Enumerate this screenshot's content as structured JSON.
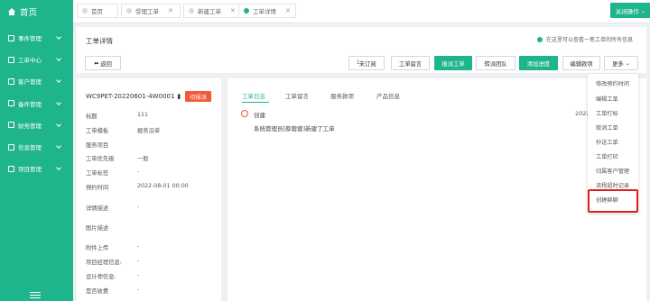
{
  "sidebar": {
    "home": "首页",
    "items": [
      {
        "label": "事件管理"
      },
      {
        "label": "工单中心"
      },
      {
        "label": "客户管理"
      },
      {
        "label": "备件管理"
      },
      {
        "label": "财务管理"
      },
      {
        "label": "信息管理"
      },
      {
        "label": "项目管理"
      }
    ]
  },
  "tabs": [
    {
      "label": "首页"
    },
    {
      "label": "受理工单"
    },
    {
      "label": "新建工单"
    },
    {
      "label": "工单详情"
    }
  ],
  "close_ops": "关闭操作",
  "page": {
    "title": "工单详情",
    "hint": "在这里可以查看一笔工单的所有信息",
    "back": "返回"
  },
  "toolbar": {
    "subscribe": "未订阅",
    "message": "工单留言",
    "dispatch": "报派工单",
    "transfer": "转派团队",
    "add_progress": "添加进度",
    "edit_cost": "编辑款项",
    "more": "更多"
  },
  "order": {
    "number": "WC9PET-20220601-4W0001",
    "status": "待报派"
  },
  "fields": [
    {
      "label": "标题",
      "value": "111"
    },
    {
      "label": "工单模板",
      "value": "报务沿单"
    },
    {
      "label": "服务项目",
      "value": ""
    },
    {
      "label": "工单优先级",
      "value": "一般"
    },
    {
      "label": "工单标签",
      "value": "-"
    },
    {
      "label": "预约时间",
      "value": "2022-08-01 00:00"
    },
    {
      "label": "详情描述",
      "value": "-"
    },
    {
      "label": "图片描述",
      "value": ""
    },
    {
      "label": "附件上传",
      "value": "-"
    },
    {
      "label": "项目经理信息:",
      "value": "-"
    },
    {
      "label": "设计师信息:",
      "value": "-"
    },
    {
      "label": "是否收费",
      "value": "-"
    }
  ],
  "detail_tabs": [
    "工单日志",
    "工单留言",
    "服务款项",
    "产品信息"
  ],
  "log": {
    "title": "创建",
    "time": "2022",
    "text": "系统管理员[蔡蓉蓉]新建了工单"
  },
  "more_menu": [
    "修改预约时间",
    "编辑工单",
    "工单打标",
    "取消工单",
    "抄送工单",
    "工单打印",
    "归属客户管理",
    "流程超时记录",
    "创建群聊"
  ]
}
